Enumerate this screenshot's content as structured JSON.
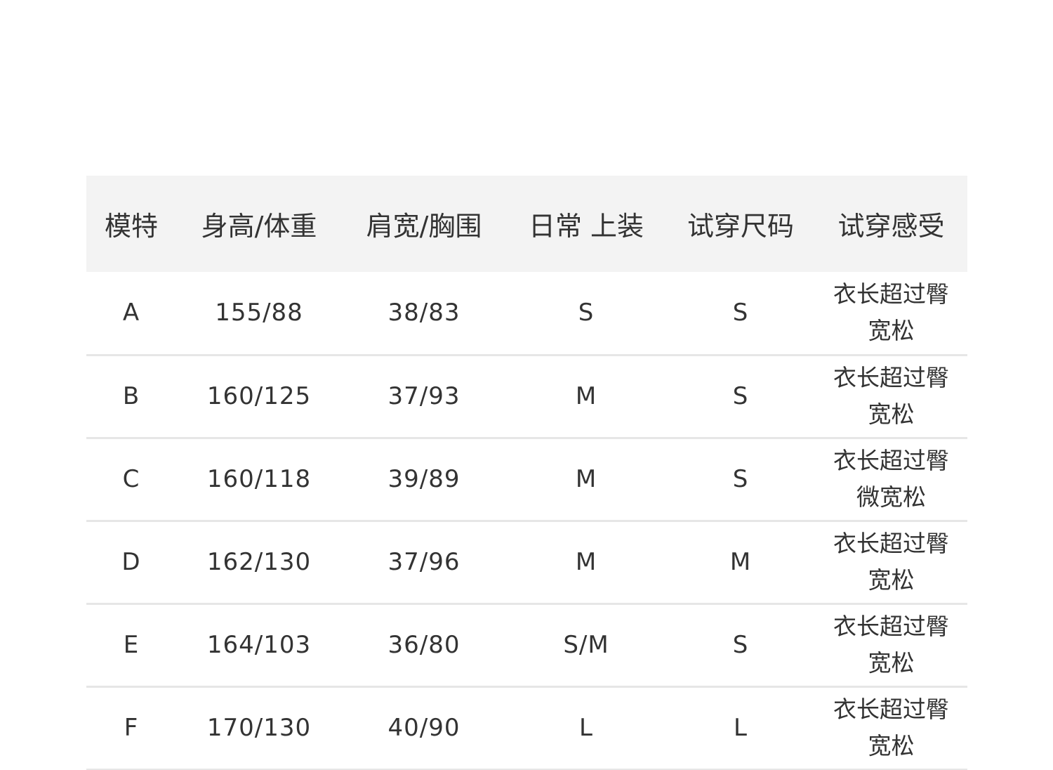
{
  "table": {
    "headers": [
      "模特",
      "身高/体重",
      "肩宽/胸围",
      "日常 上装",
      "试穿尺码",
      "试穿感受"
    ],
    "rows": [
      {
        "model": "A",
        "height_weight": "155/88",
        "shoulder_chest": "38/83",
        "daily_top": "S",
        "tried_size": "S",
        "feel_line1": "衣长超过臀",
        "feel_line2": "宽松"
      },
      {
        "model": "B",
        "height_weight": "160/125",
        "shoulder_chest": "37/93",
        "daily_top": "M",
        "tried_size": "S",
        "feel_line1": "衣长超过臀",
        "feel_line2": "宽松"
      },
      {
        "model": "C",
        "height_weight": "160/118",
        "shoulder_chest": "39/89",
        "daily_top": "M",
        "tried_size": "S",
        "feel_line1": "衣长超过臀",
        "feel_line2": "微宽松"
      },
      {
        "model": "D",
        "height_weight": "162/130",
        "shoulder_chest": "37/96",
        "daily_top": "M",
        "tried_size": "M",
        "feel_line1": "衣长超过臀",
        "feel_line2": "宽松"
      },
      {
        "model": "E",
        "height_weight": "164/103",
        "shoulder_chest": "36/80",
        "daily_top": "S/M",
        "tried_size": "S",
        "feel_line1": "衣长超过臀",
        "feel_line2": "宽松"
      },
      {
        "model": "F",
        "height_weight": "170/130",
        "shoulder_chest": "40/90",
        "daily_top": "L",
        "tried_size": "L",
        "feel_line1": "衣长超过臀",
        "feel_line2": "宽松"
      }
    ]
  }
}
